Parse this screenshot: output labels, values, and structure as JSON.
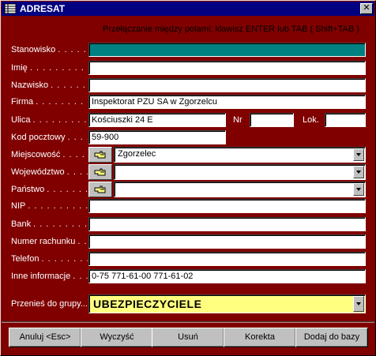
{
  "window": {
    "title": "ADRESAT",
    "close_glyph": "✕"
  },
  "hint": "Przełączanie między polami: klawisz ENTER lub TAB ( Shift+TAB )",
  "labels": {
    "stanowisko": "Stanowisko",
    "imie": "Imię",
    "nazwisko": "Nazwisko",
    "firma": "Firma",
    "ulica": "Ulica",
    "nr": "Nr",
    "lok": "Lok.",
    "kod": "Kod pocztowy",
    "miejscowosc": "Miejscowość",
    "wojewodztwo": "Województwo",
    "panstwo": "Państwo",
    "nip": "NIP",
    "bank": "Bank",
    "rachunek": "Numer rachunku",
    "telefon": "Telefon",
    "inne": "Inne informacje",
    "grupa": "Przenieś do grupy...",
    "dots": ". . . . . . . . . . . . . . . . . . . . . ."
  },
  "values": {
    "stanowisko": "",
    "imie": "",
    "nazwisko": "",
    "firma": "Inspektorat PZU SA w Zgorzelcu",
    "ulica": "Kościuszki 24 E",
    "nr": "",
    "lok": "",
    "kod": "59-900",
    "miejscowosc": "Zgorzelec",
    "wojewodztwo": "",
    "panstwo": "",
    "nip": "",
    "bank": "",
    "rachunek": "",
    "telefon": "",
    "inne": "0-75 771-61-00 771-61-02",
    "grupa": "UBEZPIECZYCIELE"
  },
  "buttons": {
    "anuluj": "Anuluj <Esc>",
    "wyczysc": "Wyczyść",
    "usun": "Usuń",
    "korekta": "Korekta",
    "dodaj": "Dodaj do bazy"
  },
  "icons": {
    "app": "table-icon",
    "picker": "hand-pointer-icon",
    "dropdown": "chevron-down-icon"
  },
  "colors": {
    "title_bar": "#000080",
    "form_bg": "#800000",
    "selected_field": "#008080",
    "group_field": "#ffff80"
  }
}
